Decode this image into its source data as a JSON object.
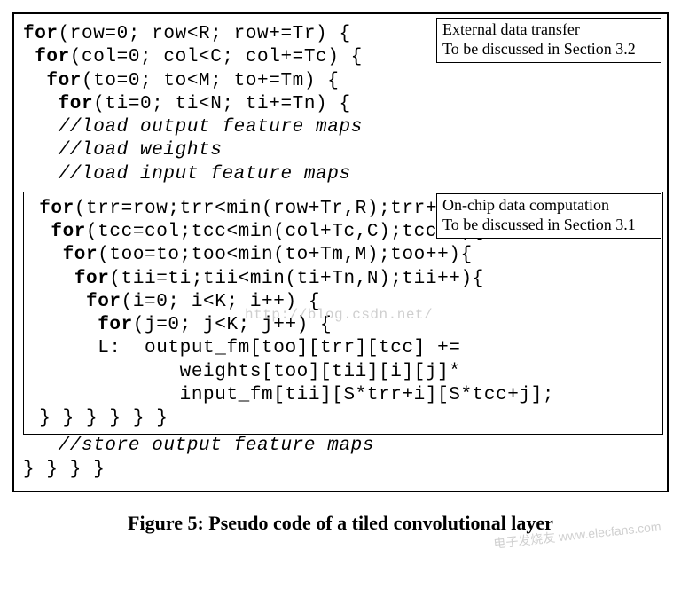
{
  "note_top": {
    "l1": "External data transfer",
    "l2": "To be discussed in Section 3.2"
  },
  "note_mid": {
    "l1": "On-chip data computation",
    "l2": "To be discussed in Section 3.1"
  },
  "outer": {
    "l1a": "for",
    "l1b": "(row=0; row<R; row+=Tr) {",
    "l2a": "for",
    "l2b": "(col=0; col<C; col+=Tc) {",
    "l3a": "for",
    "l3b": "(to=0; to<M; to+=Tm) {",
    "l4a": "for",
    "l4b": "(ti=0; ti<N; ti+=Tn) {",
    "c1": "//load output feature maps",
    "c2": "//load weights",
    "c3": "//load input feature maps"
  },
  "inner": {
    "l1a": "for",
    "l1b": "(trr=row;trr<min(row+Tr,R);trr++){",
    "l2a": "for",
    "l2b": "(tcc=col;tcc<min(col+Tc,C);tcc++){",
    "l3a": "for",
    "l3b": "(too=to;too<min(to+Tm,M);too++){",
    "l4a": "for",
    "l4b": "(tii=ti;tii<min(ti+Tn,N);tii++){",
    "l5a": "for",
    "l5b": "(i=0; i<K; i++) {",
    "l6a": "for",
    "l6b": "(j=0; j<K; j++) {",
    "b1": "L:  output_fm[too][trr][tcc] +=",
    "b2": "      weights[too][tii][i][j]*",
    "b3": "      input_fm[tii][S*trr+i][S*tcc+j];",
    "close": "} } } } } }"
  },
  "after": {
    "store": "//store output feature maps",
    "close": "} } } }"
  },
  "caption": "Figure 5:  Pseudo code of a tiled convolutional layer",
  "watermark": "http://blog.csdn.net/",
  "site_wm": "电子发烧友  www.elecfans.com"
}
